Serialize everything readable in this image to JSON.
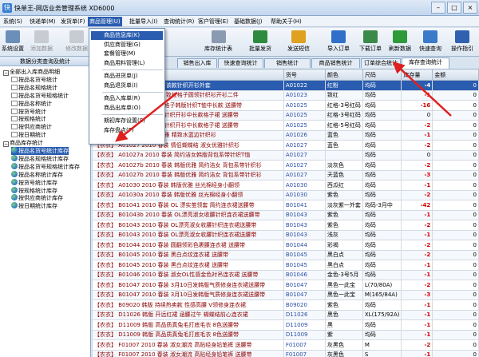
{
  "window": {
    "title": "快单王-网店业务管理系统 XD6000",
    "app_icon": "快"
  },
  "menubar": [
    {
      "label": "系统(S)",
      "name": "menu-system"
    },
    {
      "label": "快递单(M)",
      "name": "menu-express"
    },
    {
      "label": "发货单(F)",
      "name": "menu-invoice"
    },
    {
      "label": "商品管理(U)",
      "name": "menu-goods",
      "active": true
    },
    {
      "label": "批量导入(I)",
      "name": "menu-import"
    },
    {
      "label": "查询统计(R)",
      "name": "menu-query"
    },
    {
      "label": "客户管理(E)",
      "name": "menu-customer"
    },
    {
      "label": "基础数据(J)",
      "name": "menu-basic"
    },
    {
      "label": "帮助关于(H)",
      "name": "menu-help"
    }
  ],
  "toolbar": [
    {
      "label": "系统设置",
      "name": "settings",
      "icon": "gear-icon",
      "color": "#6b8fb8",
      "disabled": false
    },
    {
      "label": "添加数据",
      "name": "add-data",
      "icon": "add-icon",
      "color": "#c8ccd2",
      "disabled": true
    },
    {
      "label": "修改数据",
      "name": "edit-data",
      "icon": "edit-icon",
      "color": "#c8ccd2",
      "disabled": true
    },
    {
      "label": "库存统计表",
      "name": "inventory-report",
      "icon": "report-icon",
      "color": "#8a9ab0",
      "disabled": false
    },
    {
      "label": "批量发货",
      "name": "batch-ship",
      "icon": "ship-icon",
      "color": "#2e8b3e",
      "disabled": false
    },
    {
      "label": "发送短信",
      "name": "send-sms",
      "icon": "sms-icon",
      "color": "#e0a020",
      "disabled": false
    },
    {
      "label": "导入订单",
      "name": "import-orders",
      "icon": "import-icon",
      "color": "#3070c8",
      "disabled": false
    },
    {
      "label": "下载订单",
      "name": "download-orders",
      "icon": "download-icon",
      "color": "#3a8a4a",
      "disabled": false
    },
    {
      "label": "刷新数据",
      "name": "refresh-data",
      "icon": "refresh-icon",
      "color": "#2f9a3a",
      "disabled": false
    },
    {
      "label": "快速查询",
      "name": "quick-search",
      "icon": "search-icon",
      "color": "#3a7ac8",
      "disabled": false
    },
    {
      "label": "操作指引",
      "name": "guide",
      "icon": "guide-icon",
      "color": "#3060b0",
      "disabled": false
    }
  ],
  "dropdown": [
    {
      "label": "商品信息库(K)",
      "highlight": true
    },
    {
      "label": "供应商管理(G)"
    },
    {
      "label": "套餐管理(M)"
    },
    {
      "label": "商品用料管理(L)"
    },
    {
      "sep": true
    },
    {
      "label": "商品进货单(J)"
    },
    {
      "label": "商品退货单(I)"
    },
    {
      "sep": true
    },
    {
      "label": "商品入库单(R)"
    },
    {
      "label": "商品出库单(O)"
    },
    {
      "sep": true
    },
    {
      "label": "期初库存设置(S)"
    },
    {
      "label": "库存盘点(P)"
    }
  ],
  "left_panel": {
    "header": "数据分类查询及统计",
    "tree": [
      {
        "label": "全部出入库商品明细",
        "lvl": 0,
        "type": "box",
        "box": "−"
      },
      {
        "label": "按品名货号统计",
        "lvl": 1,
        "type": "file"
      },
      {
        "label": "按品名规格统计",
        "lvl": 1,
        "type": "file"
      },
      {
        "label": "按品名货号规格统计",
        "lvl": 1,
        "type": "file"
      },
      {
        "label": "按品名称统计",
        "lvl": 1,
        "type": "file"
      },
      {
        "label": "按货号统计",
        "lvl": 1,
        "type": "file"
      },
      {
        "label": "按规格统计",
        "lvl": 1,
        "type": "file"
      },
      {
        "label": "按供应商统计",
        "lvl": 1,
        "type": "file"
      },
      {
        "label": "按日期统计",
        "lvl": 1,
        "type": "file"
      },
      {
        "label": "商品库存统计",
        "lvl": 0,
        "type": "box",
        "box": "−"
      },
      {
        "label": "按品名货号统计库存",
        "lvl": 1,
        "type": "globe",
        "selected": true
      },
      {
        "label": "按品名规格统计库存",
        "lvl": 1,
        "type": "globe"
      },
      {
        "label": "按品名货号规格统计库存",
        "lvl": 1,
        "type": "globe"
      },
      {
        "label": "按品名称统计库存",
        "lvl": 1,
        "type": "globe"
      },
      {
        "label": "按货号统计库存",
        "lvl": 1,
        "type": "globe"
      },
      {
        "label": "按规格统计库存",
        "lvl": 1,
        "type": "globe"
      },
      {
        "label": "按供应商统计库存",
        "lvl": 1,
        "type": "globe"
      },
      {
        "label": "按日期统计库存",
        "lvl": 1,
        "type": "globe"
      }
    ]
  },
  "tabs": [
    {
      "label": "销售出入库",
      "active": false
    },
    {
      "label": "快速查询统计",
      "active": false
    },
    {
      "label": "销售统计",
      "active": false
    },
    {
      "label": "商品销售统计",
      "active": false
    },
    {
      "label": "订单综合统计",
      "active": false
    },
    {
      "label": "库存查询统计",
      "active": true
    }
  ],
  "table": {
    "columns": [
      "商品名称",
      "货号",
      "颜色",
      "尺码",
      "库存量",
      "金额"
    ],
    "rows": [
      {
        "name": "【农衣】 2010 春装 露裤子 该款针织开衫外套",
        "code": "A01022",
        "color": "红粉",
        "size": "均码",
        "qty": "-4",
        "amt": "0",
        "sel": true
      },
      {
        "name": "【农衣】 2010 春装 淑女风 致红格子圆领针织衫开衫二件",
        "code": "A01023",
        "color": "致红",
        "size": "均码",
        "qty": "-1",
        "amt": "0"
      },
      {
        "name": "【农衣】 2010 春装 淑女衣格子韩版针织T恤中长款 送腰带",
        "code": "A01025",
        "color": "红格-3号红码",
        "size": "均码",
        "qty": "-16",
        "amt": "0"
      },
      {
        "name": "【农衣】 2010 春装 淑女衣针织开衫中长款格子裙 送腰带",
        "code": "A01025",
        "color": "红格-3号红码",
        "size": "均码",
        "qty": "0",
        "amt": "0"
      },
      {
        "name": "【农衣】 2010 春装 淑女衣针织开衫中长款格子裙 送腰带",
        "code": "A01025",
        "color": "红格-5号红码",
        "size": "均码",
        "qty": "-2",
        "amt": "0"
      },
      {
        "name": "【农衣】 2010 春装 淑女优雅 精致水蓝边针织衫",
        "code": "A01026",
        "color": "蓝色",
        "size": "均码",
        "qty": "-1",
        "amt": "0"
      },
      {
        "name": "【农衣】 A01027 2010 春装 情侣蝴蝶结 淑女优雅针织衫",
        "code": "A01027",
        "color": "蓝色",
        "size": "均码",
        "qty": "-2",
        "amt": "0"
      },
      {
        "name": "【农衣】 A01027a 2010 春装 简约洁女韩版背包系带针织T恤",
        "code": "A01027",
        "color": "",
        "size": "均码",
        "qty": "0",
        "amt": "0"
      },
      {
        "name": "【农衣】 A01027b 2010 春装 韩版优雅 简约洁女 背包系带针织衫",
        "code": "A01027",
        "color": "淡灰色",
        "size": "均码",
        "qty": "-2",
        "amt": "0"
      },
      {
        "name": "【农衣】 A01027b 2010 春装 韩版优雅 简约洁女 背包系带针织衫",
        "code": "A01027",
        "color": "天蓝色",
        "size": "均码",
        "qty": "-3",
        "amt": "0"
      },
      {
        "name": "【农衣】 A01030 2010 春装 韩版优雅 丝光棉经身小翻领",
        "code": "A01030",
        "color": "西瓜红",
        "size": "均码",
        "qty": "-1",
        "amt": "0"
      },
      {
        "name": "【农衣】 A01030a 2010 春装 韩版优雅 丝光棉经身小翻领",
        "code": "A01030",
        "color": "紫色",
        "size": "均码",
        "qty": "-2",
        "amt": "0"
      },
      {
        "name": "【农衣】 B01041 2010 春装 OL 漂实茧领套 简约连衣裙送腰带",
        "code": "B01041",
        "color": "淡灰紫一外套",
        "size": "均码-3月中",
        "qty": "-42",
        "amt": "0"
      },
      {
        "name": "【农衣】 B01043b 2010 春装 OL漂亮淑女收腰针织连衣裙送腰带",
        "code": "B01043",
        "color": "紫色",
        "size": "均码",
        "qty": "-1",
        "amt": "0"
      },
      {
        "name": "【农衣】 B01043 2010 春装 OL漂亮淑女收腰针织连衣裙送腰带",
        "code": "B01043",
        "color": "紫色",
        "size": "均码",
        "qty": "-2",
        "amt": "0"
      },
      {
        "name": "【农衣】 B01043 2010 春装 OL漂亮淑女收腰针织连衣裙送腰带",
        "code": "B01043",
        "color": "浅灰",
        "size": "均码",
        "qty": "-1",
        "amt": "0"
      },
      {
        "name": "【农衣】 B01044 2010 春装 圆翻领彩色裹腰连衣裙 送腰带",
        "code": "B01044",
        "color": "彩褐",
        "size": "均码",
        "qty": "-2",
        "amt": "0"
      },
      {
        "name": "【农衣】 B01045 2010 春装 黑白点纹连衣裙 送腰带",
        "code": "B01045",
        "color": "黑白点",
        "size": "均码",
        "qty": "-2",
        "amt": "0"
      },
      {
        "name": "【农衣】 B01045 2010 春装 黑白点纹连衣裙 送腰带",
        "code": "B01045",
        "color": "黑白点",
        "size": "均码",
        "qty": "-1",
        "amt": "0"
      },
      {
        "name": "【农衣】 B01046 2010 春装 淑女OL性感金色衬吊连衣裙 送腰带",
        "code": "B01046",
        "color": "金色-3号5月",
        "size": "均码",
        "qty": "-1",
        "amt": "0"
      },
      {
        "name": "【农衣】 B01047 2010 春装 3月10日发韩版气质修身连衣裙送腰带",
        "code": "B01047",
        "color": "黑色一此宝",
        "size": "L(70/80A)",
        "qty": "-2",
        "amt": "0"
      },
      {
        "name": "【农衣】 B01047 2010 春装 3月10日发韩版气质修身连衣裙送腰带",
        "code": "B01047",
        "color": "黑色一此宝",
        "size": "M(165/84A)",
        "qty": "-3",
        "amt": "0"
      },
      {
        "name": "【农衣】 B09020 韩版 持续热卖款 性感高腰 V领修身连衣裙",
        "code": "B09020",
        "color": "紫色",
        "size": "均码",
        "qty": "-1",
        "amt": "0"
      },
      {
        "name": "【农衣】 D11026 韩版 开远红裙 涵腰过午 蝴蝶结前心连衣裙",
        "code": "D11026",
        "color": "黑色",
        "size": "XL(175/92A)",
        "qty": "-1",
        "amt": "0"
      },
      {
        "name": "【农衣】 D11009 韩版 高品质真兔毛打底毛衣 8色送腰带",
        "code": "D11009",
        "color": "黑",
        "size": "均码",
        "qty": "-1",
        "amt": "0"
      },
      {
        "name": "【农衣】 D11009 韩版 高品质真兔毛打底毛衣 8色送腰带",
        "code": "D11009",
        "color": "紫",
        "size": "均码",
        "qty": "-1",
        "amt": "0"
      },
      {
        "name": "【农衣】 F01007 2010 春装 淑女潮流 高贴经身铅笔裤 送腰带",
        "code": "F01007",
        "color": "灰黑色",
        "size": "M",
        "qty": "-2",
        "amt": "0"
      },
      {
        "name": "【农衣】 F01007 2010 春装 淑女潮流 高贴经身铅笔裤 送腰带",
        "code": "F01007",
        "color": "灰黑色",
        "size": "S",
        "qty": "-1",
        "amt": "0"
      },
      {
        "name": "【农衣】 F01007 2010 春装 淑女潮流 高贴经身铅笔裤 送腰带",
        "code": "F01007",
        "color": "灰黑色",
        "size": "L",
        "qty": "-1",
        "amt": "0"
      }
    ]
  },
  "annotation_color": "#e02020"
}
